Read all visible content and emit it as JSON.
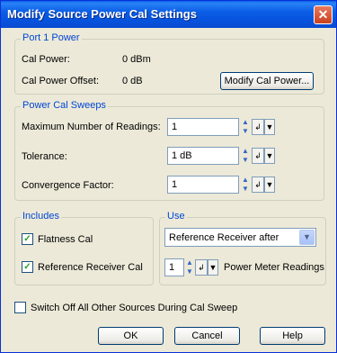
{
  "window": {
    "title": "Modify Source Power Cal Settings",
    "close_glyph": "✕"
  },
  "port1": {
    "legend": "Port 1 Power",
    "cal_power_label": "Cal Power:",
    "cal_power_value": "0 dBm",
    "offset_label": "Cal Power Offset:",
    "offset_value": "0 dB",
    "modify_button": "Modify Cal Power..."
  },
  "sweeps": {
    "legend": "Power Cal Sweeps",
    "max_readings_label": "Maximum Number of Readings:",
    "max_readings_value": "1",
    "tolerance_label": "Tolerance:",
    "tolerance_value": "1 dB",
    "convergence_label": "Convergence Factor:",
    "convergence_value": "1"
  },
  "includes": {
    "legend": "Includes",
    "flatness_label": "Flatness Cal",
    "flatness_checked": true,
    "ref_receiver_label": "Reference Receiver Cal",
    "ref_receiver_checked": true
  },
  "use": {
    "legend": "Use",
    "mode_selected": "Reference Receiver after",
    "readings_value": "1",
    "readings_suffix": "Power Meter Readings"
  },
  "switch_off": {
    "label": "Switch Off All Other Sources During Cal Sweep",
    "checked": false
  },
  "buttons": {
    "ok": "OK",
    "cancel": "Cancel",
    "help": "Help"
  },
  "glyphs": {
    "spin_up": "▲",
    "spin_down": "▼",
    "keypad": "↲",
    "dropdown": "▼",
    "check": "✓"
  }
}
